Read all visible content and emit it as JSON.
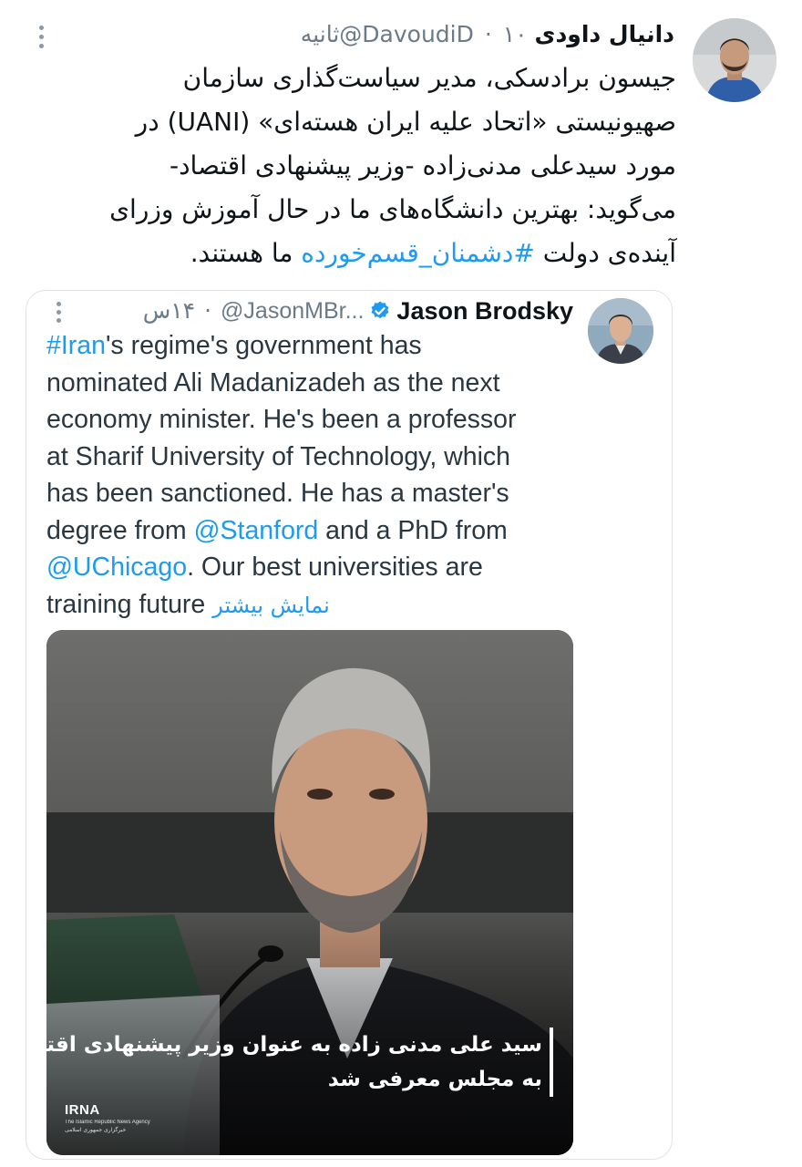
{
  "tweet": {
    "author_name": "دانیال داودی",
    "handle": "@DavoudiD",
    "separator": "·",
    "time": "۱۰ثانیه",
    "text_lines": [
      "جیسون برادسکی، مدیر سیاست‌گذاری سازمان",
      "صهیونیستی «اتحاد علیه ایران هسته‌ای» (UANI) در",
      "مورد سیدعلی مدنی‌زاده -وزیر پیشنهادی اقتصاد-",
      "می‌گوید: بهترین دانشگاه‌های ما در حال آموزش وزرای"
    ],
    "last_line_prefix": "آینده‌ی دولت",
    "hashtag": "#دشمنان_قسم‌خورده",
    "last_line_suffix": "ما هستند."
  },
  "quoted_tweet": {
    "author_name": "Jason Brodsky",
    "handle": "@JasonMBr...",
    "separator": "·",
    "time": "۱۴س",
    "text": {
      "line1_hashtag": "#Iran",
      "line1_rest": "'s regime's government has",
      "line2": "nominated Ali Madanizadeh as the next",
      "line3": "economy minister. He's been a professor",
      "line4": "at Sharif University of Technology, which",
      "line5": "has been sanctioned. He has a master's",
      "line6_prefix": "degree from ",
      "line6_mention": "@Stanford",
      "line6_suffix": " and a PhD from",
      "line7_mention": "@UChicago",
      "line7_suffix": ". Our best universities are",
      "line8": "training future "
    },
    "show_more": "نمایش بیشتر",
    "image": {
      "caption_line1": "سید علی مدنی زاده به عنوان وزیر پیشنهادی اقتصاد",
      "caption_line2": "به مجلس معرفی شد",
      "logo_text": "IRNA",
      "logo_subtext": "The Islamic Republic News Agency",
      "logo_subtext_fa": "خبرگزاری جمهوری اسلامی"
    }
  },
  "colors": {
    "link": "#1d9bf0",
    "text": "#0f1419",
    "muted": "#6b7a88",
    "border": "#dfe3e6"
  },
  "icons": {
    "more": "more-vertical-icon",
    "verified": "verified-badge-icon"
  }
}
